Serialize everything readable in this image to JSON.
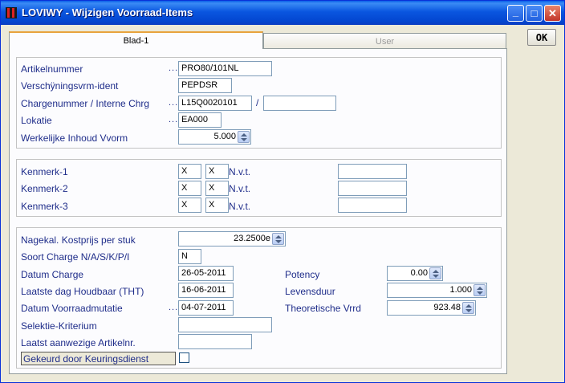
{
  "window": {
    "title": "LOVIWY - Wijzigen Voorraad-Items",
    "min_symbol": "_",
    "max_symbol": "□",
    "close_symbol": "✕"
  },
  "toolbar": {
    "ok_label": "OK"
  },
  "tabs": [
    {
      "label": "Blad-1",
      "active": true
    },
    {
      "label": "User",
      "active": false
    }
  ],
  "group1": {
    "artikelnummer": {
      "label": "Artikelnummer",
      "value": "PRO80/101NL"
    },
    "verschijning": {
      "label": "Verschÿningsvrm-ident",
      "value": "PEPDSR"
    },
    "charge": {
      "label": "Chargenummer / Interne Chrg",
      "value": "L15Q0020101",
      "sep": "/",
      "value2": ""
    },
    "lokatie": {
      "label": "Lokatie",
      "value": "EA000"
    },
    "inhoud": {
      "label": "Werkelijke Inhoud Vvorm",
      "value": "5.000"
    },
    "dots": "..."
  },
  "group2": {
    "kenmerken": [
      {
        "label": "Kenmerk-1",
        "v1": "X",
        "v2": "X",
        "text": "N.v.t.",
        "extra": ""
      },
      {
        "label": "Kenmerk-2",
        "v1": "X",
        "v2": "X",
        "text": "N.v.t.",
        "extra": ""
      },
      {
        "label": "Kenmerk-3",
        "v1": "X",
        "v2": "X",
        "text": "N.v.t.",
        "extra": ""
      }
    ]
  },
  "group3": {
    "kostprijs": {
      "label": "Nagekal. Kostprijs per stuk",
      "value": "23.2500e"
    },
    "soort": {
      "label": "Soort Charge N/A/S/K/P/I",
      "value": "N"
    },
    "datum_charge": {
      "label": "Datum Charge",
      "value": "26-05-2011"
    },
    "tht": {
      "label": "Laatste dag Houdbaar (THT)",
      "value": "16-06-2011"
    },
    "mutatie": {
      "label": "Datum Voorraadmutatie",
      "value": "04-07-2011"
    },
    "selektie": {
      "label": "Selektie-Kriterium",
      "value": ""
    },
    "laatst": {
      "label": "Laatst aanwezige Artikelnr.",
      "value": ""
    },
    "gekeurd": {
      "label": "Gekeurd door Keuringsdienst",
      "checked": false
    },
    "potency": {
      "label": "Potency",
      "value": "0.00"
    },
    "levensduur": {
      "label": "Levensduur",
      "value": "1.000"
    },
    "vrrd": {
      "label": "Theoretische Vrrd",
      "value": "923.48"
    },
    "dots": "..."
  }
}
